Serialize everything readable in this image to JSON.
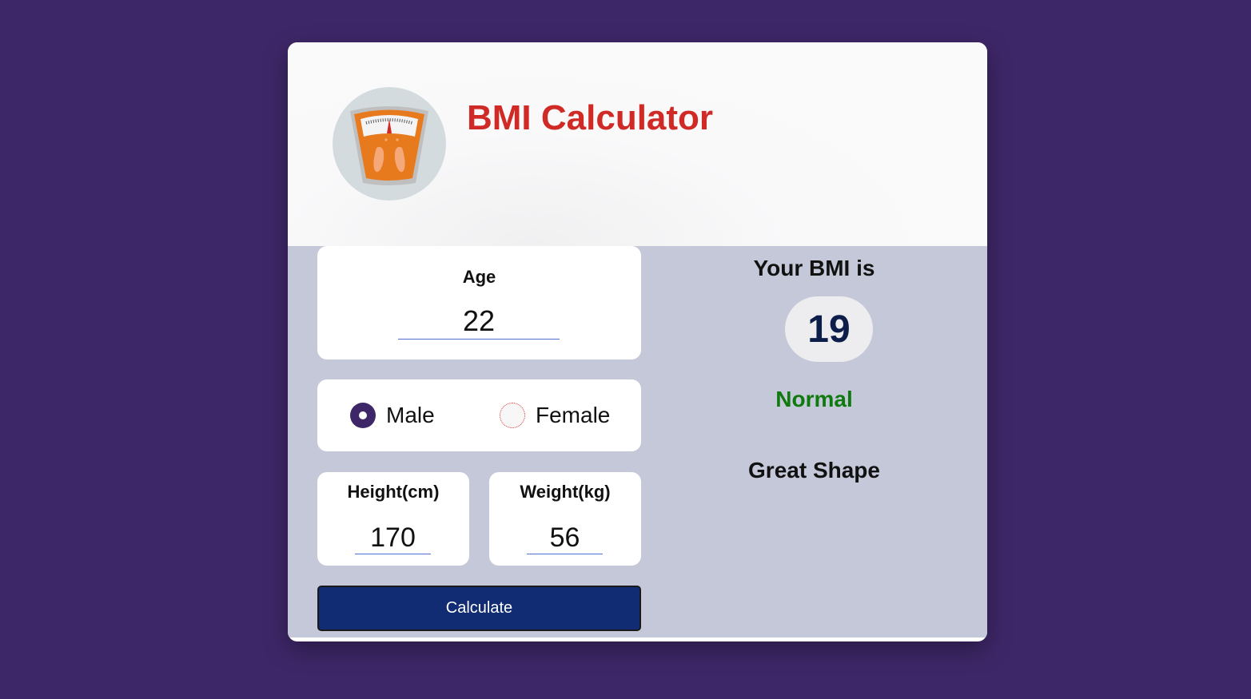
{
  "header": {
    "title": "BMI Calculator",
    "logo_icon": "weighing-scale-icon"
  },
  "form": {
    "age": {
      "label": "Age",
      "value": "22"
    },
    "gender": {
      "options": [
        {
          "label": "Male",
          "checked": true
        },
        {
          "label": "Female",
          "checked": false
        }
      ]
    },
    "height": {
      "label": "Height(cm)",
      "value": "170"
    },
    "weight": {
      "label": "Weight(kg)",
      "value": "56"
    },
    "calculate_label": "Calculate"
  },
  "result": {
    "label": "Your BMI is",
    "value": "19",
    "status": "Normal",
    "advice": "Great Shape"
  },
  "colors": {
    "page_background": "#3e2768",
    "title": "#d02a26",
    "button": "#112c72",
    "status_normal": "#107a10",
    "panel_background": "#c4c8d8"
  }
}
